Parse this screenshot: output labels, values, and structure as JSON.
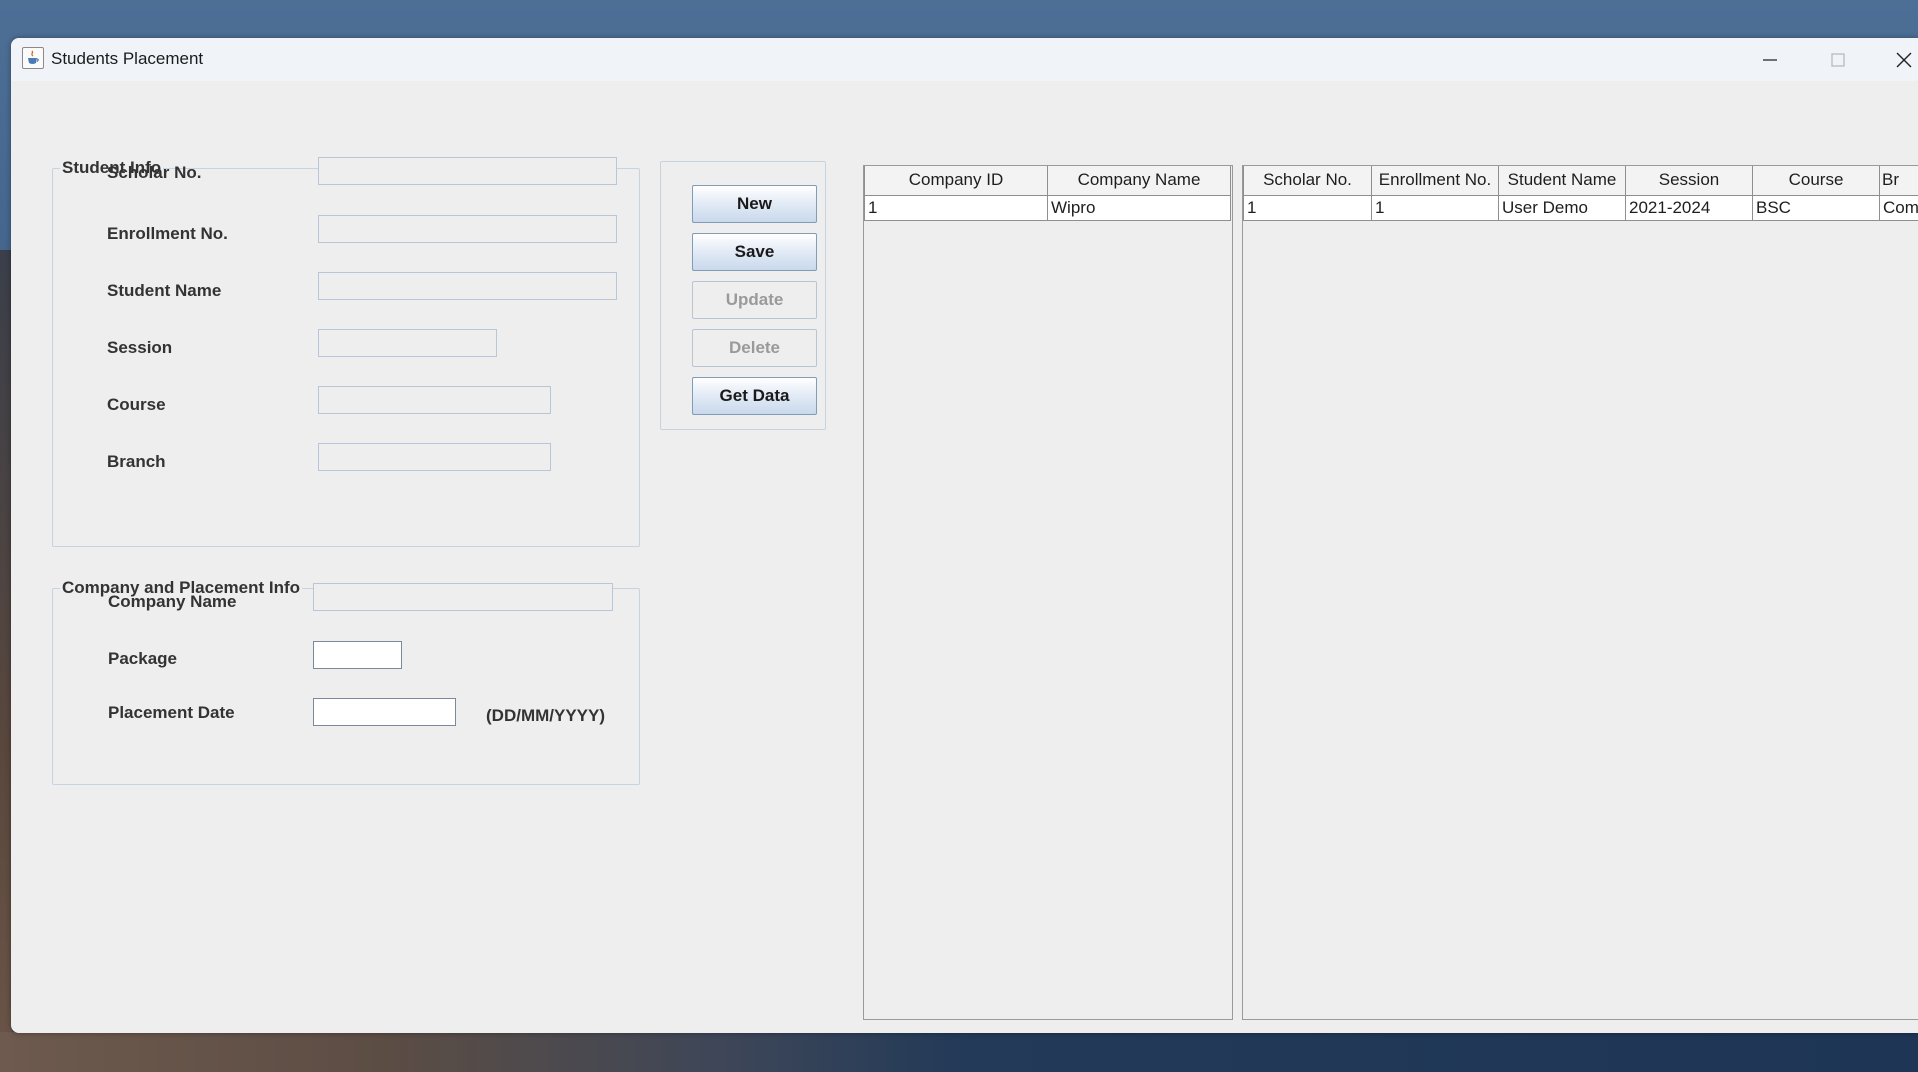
{
  "window": {
    "title": "Students Placement"
  },
  "student_info": {
    "legend": "Student Info",
    "scholar_no_label": "Scholar No.",
    "scholar_no_value": "",
    "enrollment_no_label": "Enrollment No.",
    "enrollment_no_value": "",
    "student_name_label": "Student Name",
    "student_name_value": "",
    "session_label": "Session",
    "session_value": "",
    "course_label": "Course",
    "course_value": "",
    "branch_label": "Branch",
    "branch_value": ""
  },
  "placement_info": {
    "legend": "Company and Placement Info",
    "company_name_label": "Company Name",
    "company_name_value": "",
    "package_label": "Package",
    "package_value": "",
    "placement_date_label": "Placement Date",
    "placement_date_value": "",
    "date_format_hint": "(DD/MM/YYYY)"
  },
  "actions": {
    "new_label": "New",
    "save_label": "Save",
    "update_label": "Update",
    "delete_label": "Delete",
    "get_data_label": "Get Data"
  },
  "company_table": {
    "columns": [
      "Company ID",
      "Company Name"
    ],
    "rows": [
      [
        "1",
        "Wipro"
      ]
    ]
  },
  "student_table": {
    "columns": [
      "Scholar No.",
      "Enrollment No.",
      "Student Name",
      "Session",
      "Course",
      "Br"
    ],
    "rows": [
      [
        "1",
        "1",
        "User Demo",
        "2021-2024",
        "BSC",
        "Comp"
      ]
    ]
  }
}
